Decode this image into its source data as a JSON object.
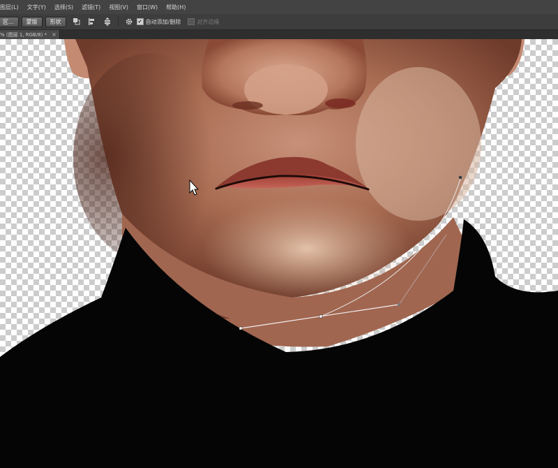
{
  "menu": [
    "图层(L)",
    "文字(Y)",
    "选择(S)",
    "滤镜(T)",
    "视图(V)",
    "窗口(W)",
    "帮助(H)"
  ],
  "options_bar": {
    "button1": "区...",
    "button2": "蒙版",
    "button3": "形状",
    "auto_add_delete_label": "自动添加/删除",
    "auto_add_delete_checked": true,
    "align_edges_label": "对齐边缘",
    "align_edges_checked": false
  },
  "document_tab": {
    "title": "% (图层 1, RGB/8) *",
    "close": "×"
  },
  "colors": {
    "menubar": "#434343",
    "options_bar": "#3d3d3d",
    "sweater": "#050505",
    "skin_mid": "#a66b50",
    "path_stroke": "#f0f0f0"
  },
  "icons": [
    "path-operations-icon",
    "path-alignment-icon",
    "path-arrangement-icon",
    "gear-icon",
    "mouse-cursor-icon"
  ]
}
